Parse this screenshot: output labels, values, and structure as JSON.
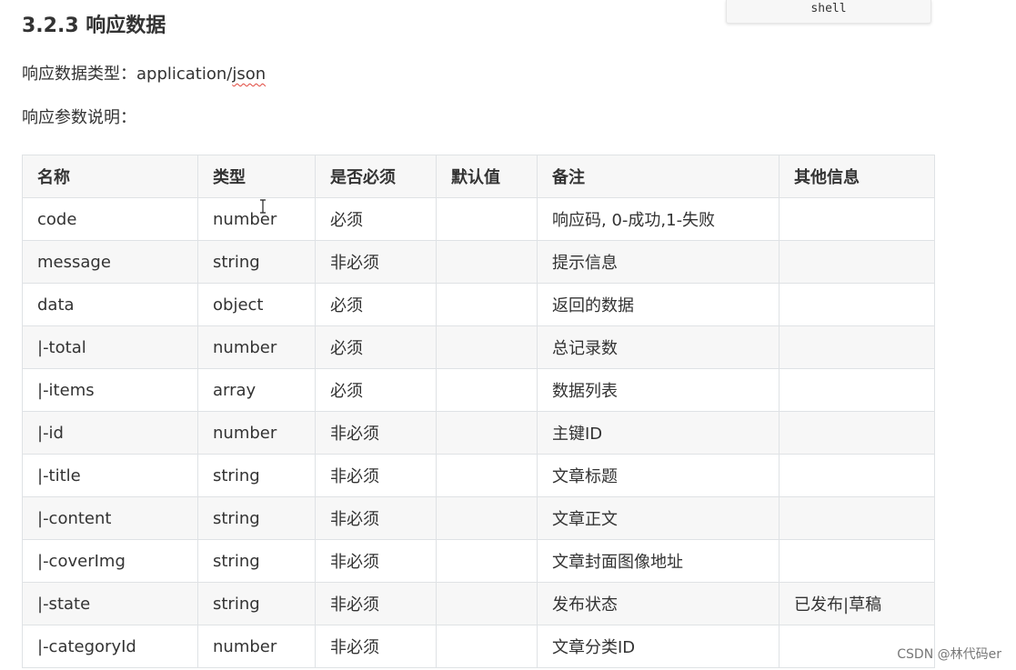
{
  "code_tab": {
    "label": "shell"
  },
  "section": {
    "heading": "3.2.3 响应数据",
    "type_label": "响应数据类型：application/",
    "type_value": "json",
    "params_label": "响应参数说明："
  },
  "table": {
    "headers": [
      "名称",
      "类型",
      "是否必须",
      "默认值",
      "备注",
      "其他信息"
    ],
    "rows": [
      [
        "code",
        "number",
        "必须",
        "",
        "响应码, 0-成功,1-失败",
        ""
      ],
      [
        "message",
        "string",
        "非必须",
        "",
        "提示信息",
        ""
      ],
      [
        "data",
        "object",
        "必须",
        "",
        "返回的数据",
        ""
      ],
      [
        "|-total",
        "number",
        "必须",
        "",
        "总记录数",
        ""
      ],
      [
        "|-items",
        "array",
        "必须",
        "",
        "数据列表",
        ""
      ],
      [
        "|-id",
        "number",
        "非必须",
        "",
        "主键ID",
        ""
      ],
      [
        "|-title",
        "string",
        "非必须",
        "",
        "文章标题",
        ""
      ],
      [
        "|-content",
        "string",
        "非必须",
        "",
        "文章正文",
        ""
      ],
      [
        "|-coverImg",
        "string",
        "非必须",
        "",
        "文章封面图像地址",
        ""
      ],
      [
        "|-state",
        "string",
        "非必须",
        "",
        "发布状态",
        "已发布|草稿"
      ],
      [
        "|-categoryId",
        "number",
        "非必须",
        "",
        "文章分类ID",
        ""
      ]
    ]
  },
  "watermark": "CSDN @林代码er"
}
